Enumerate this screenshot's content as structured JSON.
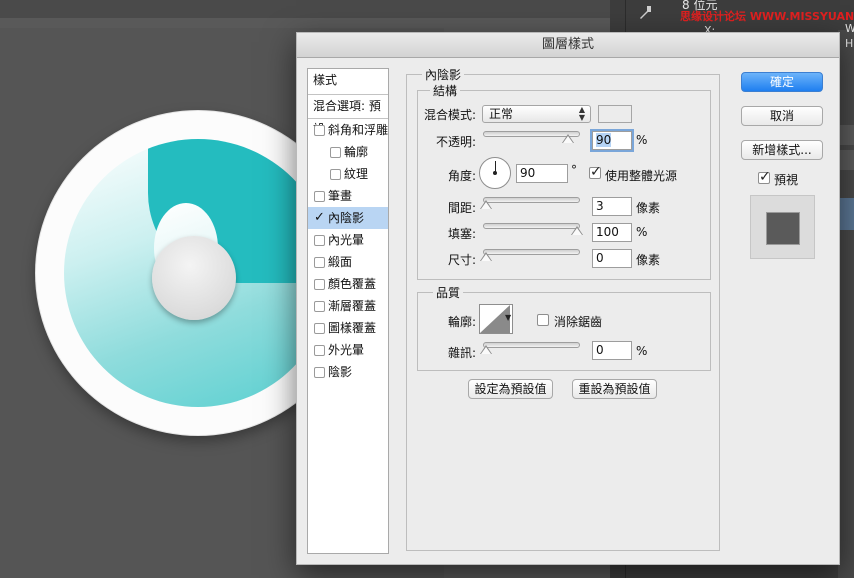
{
  "right_panel": {
    "depth": "8 位元",
    "x_label": "X:",
    "side_w": "W",
    "side_h": "H",
    "watermark": "思缘设计论坛 WWW.MISSYUAN.COM"
  },
  "dialog": {
    "title": "圖層樣式",
    "styles_header": "樣式",
    "blend_options": "混合選項: 預設",
    "style_items": [
      {
        "label": "斜角和浮雕",
        "checked": false,
        "indent": false,
        "selected": false
      },
      {
        "label": "輪廓",
        "checked": false,
        "indent": true,
        "selected": false
      },
      {
        "label": "紋理",
        "checked": false,
        "indent": true,
        "selected": false
      },
      {
        "label": "筆畫",
        "checked": false,
        "indent": false,
        "selected": false
      },
      {
        "label": "內陰影",
        "checked": true,
        "indent": false,
        "selected": true
      },
      {
        "label": "內光暈",
        "checked": false,
        "indent": false,
        "selected": false
      },
      {
        "label": "緞面",
        "checked": false,
        "indent": false,
        "selected": false
      },
      {
        "label": "顏色覆蓋",
        "checked": false,
        "indent": false,
        "selected": false
      },
      {
        "label": "漸層覆蓋",
        "checked": false,
        "indent": false,
        "selected": false
      },
      {
        "label": "圖樣覆蓋",
        "checked": false,
        "indent": false,
        "selected": false
      },
      {
        "label": "外光暈",
        "checked": false,
        "indent": false,
        "selected": false
      },
      {
        "label": "陰影",
        "checked": false,
        "indent": false,
        "selected": false
      }
    ],
    "inner_shadow": {
      "section_title": "內陰影",
      "structure_title": "結構",
      "blend_mode_label": "混合模式:",
      "blend_mode_value": "正常",
      "opacity_label": "不透明:",
      "opacity_value": "90",
      "opacity_unit": "%",
      "opacity_level": 0.9,
      "angle_label": "角度:",
      "angle_value": "90",
      "angle_unit": "°",
      "global_light_label": "使用整體光源",
      "global_light_checked": true,
      "distance_label": "間距:",
      "distance_value": "3",
      "distance_unit": "像素",
      "distance_level": 0.0,
      "choke_label": "填塞:",
      "choke_value": "100",
      "choke_unit": "%",
      "choke_level": 1.0,
      "size_label": "尺寸:",
      "size_value": "0",
      "size_unit": "像素",
      "size_level": 0.0
    },
    "quality": {
      "title": "品質",
      "contour_label": "輪廓:",
      "anti_alias_label": "消除鋸齒",
      "anti_alias_checked": false,
      "noise_label": "雜訊:",
      "noise_value": "0",
      "noise_unit": "%",
      "noise_level": 0.0
    },
    "make_default_button": "設定為預設值",
    "reset_default_button": "重設為預設值",
    "ok_button": "確定",
    "cancel_button": "取消",
    "new_style_button": "新增樣式...",
    "preview_label": "預視",
    "preview_checked": true
  }
}
